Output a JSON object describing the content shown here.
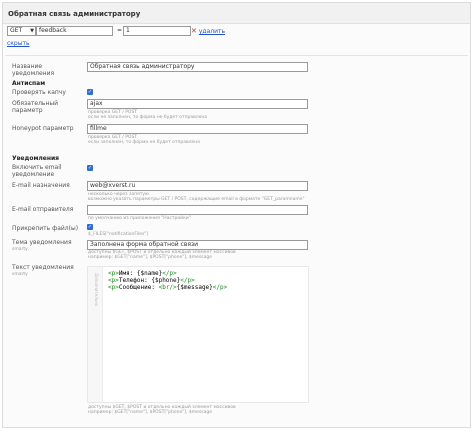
{
  "header": {
    "title": "Обратная связь администратору"
  },
  "condition": {
    "method": "GET",
    "field": "feedback",
    "equals": "=",
    "value": "1",
    "delete_label": "удалить"
  },
  "hide_link": "скрыть",
  "fields": {
    "notification_name": {
      "label": "Название уведомления",
      "value": "Обратная связь администратору"
    },
    "antispam_title": "Антиспам",
    "check_captcha": {
      "label": "Проверять капчу",
      "checked": true
    },
    "required_param": {
      "label": "Обязательный параметр",
      "value": "ajax",
      "hint1": "проверка GET / POST",
      "hint2": "если не заполнен, то форма не будет отправлена"
    },
    "honeypot": {
      "label": "Honeypot параметр",
      "value": "fillme",
      "hint1": "проверка GET / POST",
      "hint2": "если заполнен, то форма не будет отправлена"
    },
    "notifications_title": "Уведомления",
    "enable_email": {
      "label1": "Включить email",
      "label2": "уведомление",
      "checked": true
    },
    "email_to": {
      "label": "E-mail назначения",
      "value": "web@xverst.ru",
      "hint1": "несколько через запятую",
      "hint2": "возможно указать параметры GET / POST, содержащие email в формате \"GET_paramname\""
    },
    "email_from": {
      "label": "E-mail отправителя",
      "value": "",
      "hint1": "по умолчанию из приложения \"Настройки\""
    },
    "attach_files": {
      "label": "Прикрепить файл(ы)",
      "checked": true,
      "hint1": "$_FILES[\"notificationFiles\"]"
    },
    "subject": {
      "label": "Тема уведомления",
      "sub": "smarty",
      "value": "Заполнена форма обратной связи",
      "hint1": "доступны $GET, $POST и отдельно каждый элемент массивов",
      "hint2": "например: $GET[\"name\"], $POST[\"phone\"], $message"
    },
    "body": {
      "label": "Текст уведомления",
      "sub": "smarty",
      "gutter": "Дополнительно",
      "line1": {
        "open": "<p>",
        "text": "Имя: ",
        "var": "{$name}",
        "close": "</p>"
      },
      "line2": {
        "open": "<p>",
        "text": "Телефон: ",
        "var": "{$phone}",
        "close": "</p>"
      },
      "line3": {
        "open": "<p>",
        "text": "Сообщение: ",
        "br": "<br/>",
        "var": "{$message}",
        "close": "</p>"
      },
      "hint1": "доступны $GET, $POST и отдельно каждый элемент массивов",
      "hint2": "например: $GET[\"name\"], $POST[\"phone\"], $message"
    }
  }
}
